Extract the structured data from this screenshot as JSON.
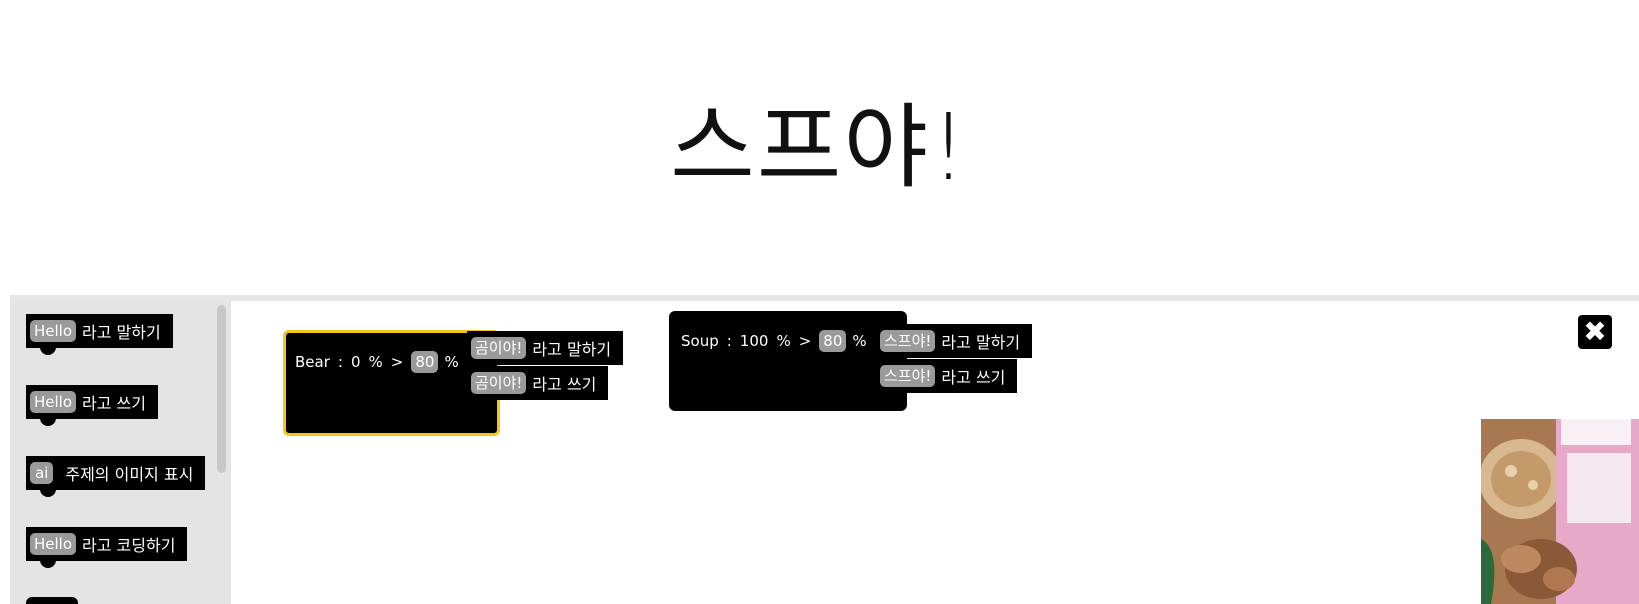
{
  "header": {
    "title": "스프야!"
  },
  "toolbox": {
    "blocks": [
      {
        "pill": "Hello",
        "text": "라고 말하기"
      },
      {
        "pill": "Hello",
        "text": "라고 쓰기"
      },
      {
        "pill": "ai",
        "text": "주제의 이미지 표시"
      },
      {
        "pill": "Hello",
        "text": "라고 코딩하기"
      }
    ]
  },
  "workspace": {
    "event1": {
      "name": "Bear",
      "colon": ":",
      "value": "0",
      "unit": "%",
      "op": ">",
      "threshold": "80",
      "unit2": "%",
      "actions": [
        {
          "pill": "곰이야!",
          "text": "라고 말하기"
        },
        {
          "pill": "곰이야!",
          "text": "라고 쓰기"
        }
      ]
    },
    "event2": {
      "name": "Soup",
      "colon": ":",
      "value": "100",
      "unit": "%",
      "op": ">",
      "threshold": "80",
      "unit2": "%",
      "actions": [
        {
          "pill": "스프야!",
          "text": "라고 말하기"
        },
        {
          "pill": "스프야!",
          "text": "라고 쓰기"
        }
      ]
    }
  },
  "close_icon": "close-icon",
  "colors": {
    "block": "#000000",
    "selected_outline": "#f5c518",
    "pill": "#9a9a9a",
    "toolbox_bg": "#e4e4e4"
  }
}
